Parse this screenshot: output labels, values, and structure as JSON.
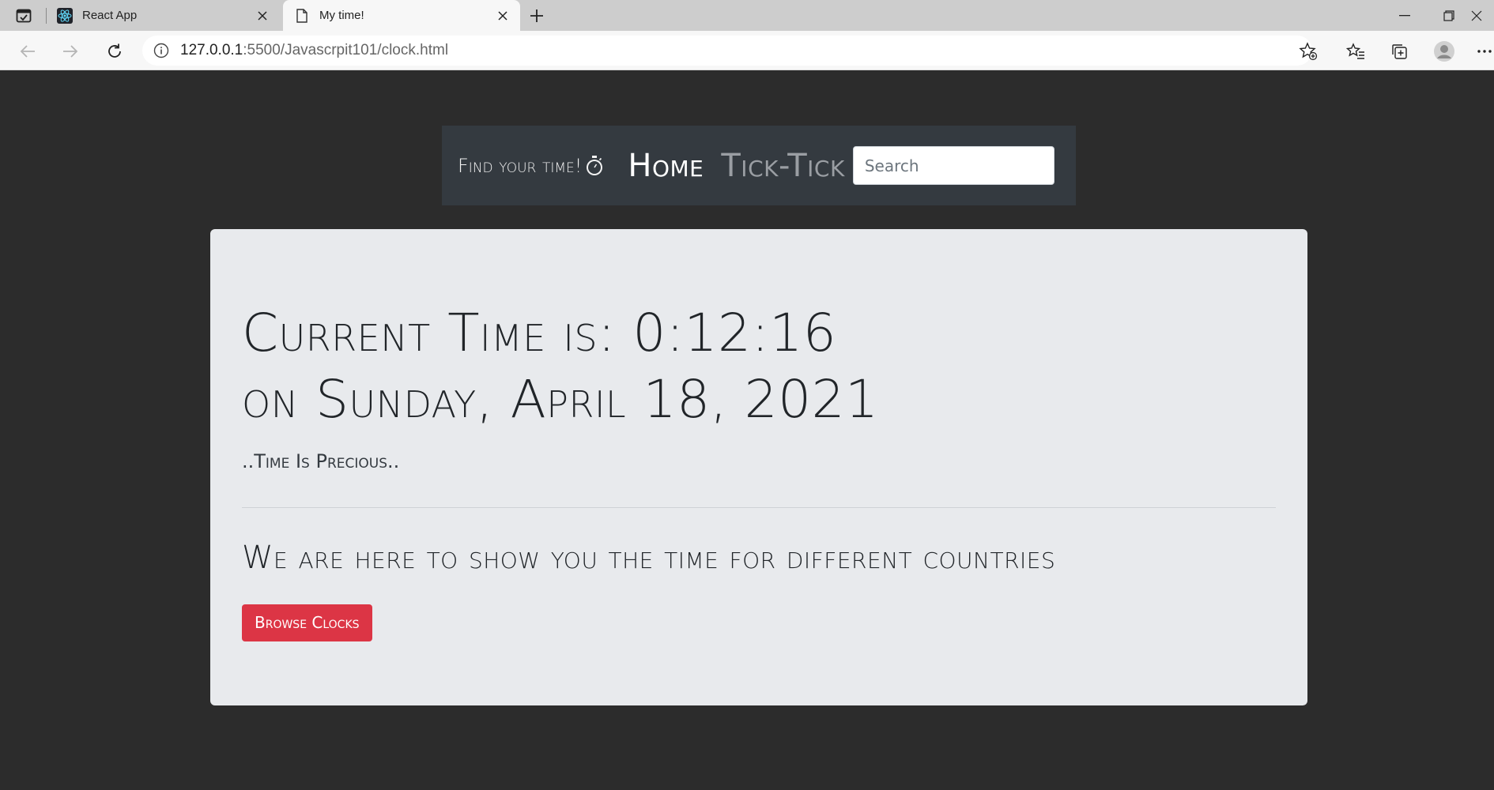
{
  "browser": {
    "tabs": [
      {
        "title": "React App",
        "icon": "react-icon"
      },
      {
        "title": "My time!",
        "icon": "page-icon"
      }
    ],
    "url_host": "127.0.0.1",
    "url_path": ":5500/Javascrpit101/clock.html"
  },
  "navbar": {
    "brand": "Find your time!",
    "home": "Home",
    "tick": "Tick-Tick",
    "search_placeholder": "Search"
  },
  "jumbotron": {
    "time_line": "Current Time is: 0:12:16",
    "date_line": "on Sunday, April 18, 2021",
    "tagline": "..Time Is Precious..",
    "lead": "We are here to show you the time for different countries",
    "button": "Browse Clocks"
  },
  "colors": {
    "page_bg": "#2c2c2c",
    "navbar_bg": "#343a40",
    "jumbotron_bg": "#e8eaed",
    "button_bg": "#dc3545"
  }
}
